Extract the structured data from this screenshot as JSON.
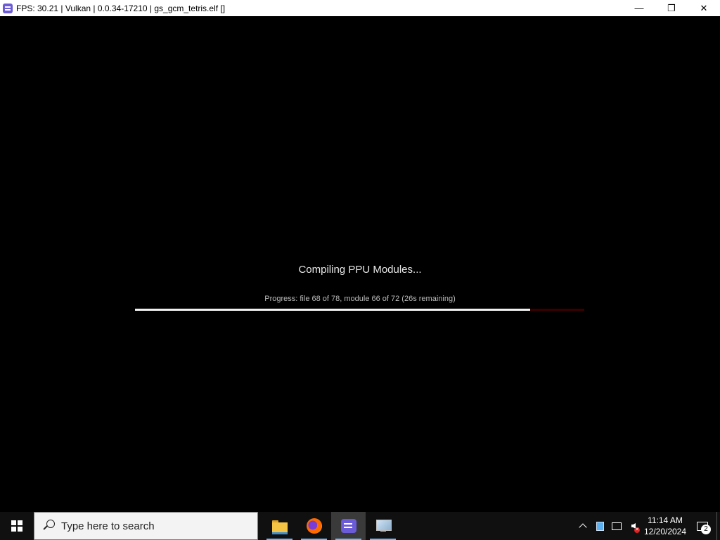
{
  "window": {
    "title": "FPS: 30.21 | Vulkan | 0.0.34-17210 | gs_gcm_tetris.elf []",
    "minimize_glyph": "—",
    "restore_glyph": "❐",
    "close_glyph": "✕"
  },
  "game": {
    "compile_title": "Compiling PPU Modules...",
    "progress_text": "Progress: file 68 of 78, module 66 of 72 (26s remaining)",
    "progress_fraction": 0.88,
    "progress_track_color": "#3a0000",
    "progress_fill_color": "#f2f2f2"
  },
  "taskbar": {
    "search_placeholder": "Type here to search",
    "apps": [
      {
        "name": "File Explorer",
        "icon": "folder-icon",
        "open": true,
        "active": false
      },
      {
        "name": "Firefox",
        "icon": "firefox-icon",
        "open": true,
        "active": false
      },
      {
        "name": "RPCS3",
        "icon": "rpcs3-icon",
        "open": true,
        "active": true
      },
      {
        "name": "Display",
        "icon": "monitor-icon",
        "open": true,
        "active": false
      }
    ],
    "clock": {
      "time": "11:14 AM",
      "date": "12/20/2024"
    },
    "notification_count": "2",
    "accent_color": "#76b9ed"
  }
}
